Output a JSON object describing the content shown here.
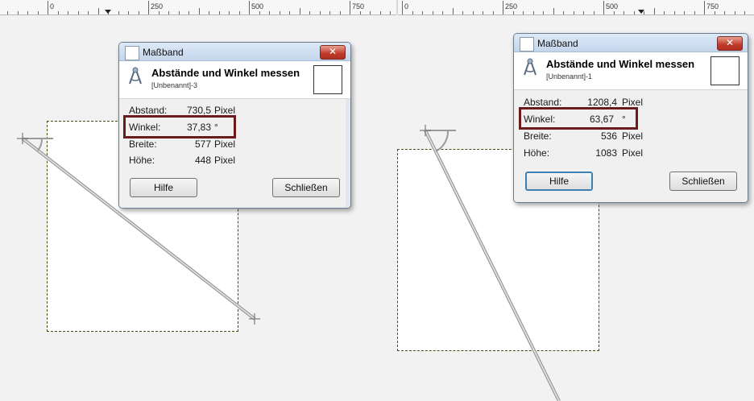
{
  "ruler_left": {
    "labels": [
      "0",
      "250",
      "500",
      "750"
    ]
  },
  "ruler_right": {
    "labels": [
      "0",
      "250",
      "500",
      "750"
    ]
  },
  "dialogs": [
    {
      "window_title": "Maßband",
      "close_glyph": "✕",
      "header_title": "Abstände und Winkel messen",
      "header_subtitle": "[Unbenannt]-3",
      "rows": [
        {
          "label": "Abstand:",
          "value": "730,5",
          "unit": "Pixel"
        },
        {
          "label": "Winkel:",
          "value": "37,83",
          "unit": "°"
        },
        {
          "label": "Breite:",
          "value": "577",
          "unit": "Pixel"
        },
        {
          "label": "Höhe:",
          "value": "448",
          "unit": "Pixel"
        }
      ],
      "help_label": "Hilfe",
      "close_label": "Schließen"
    },
    {
      "window_title": "Maßband",
      "close_glyph": "✕",
      "header_title": "Abstände und Winkel messen",
      "header_subtitle": "[Unbenannt]-1",
      "rows": [
        {
          "label": "Abstand:",
          "value": "1208,4",
          "unit": "Pixel"
        },
        {
          "label": "Winkel:",
          "value": "63,67",
          "unit": "°"
        },
        {
          "label": "Breite:",
          "value": "536",
          "unit": "Pixel"
        },
        {
          "label": "Höhe:",
          "value": "1083",
          "unit": "Pixel"
        }
      ],
      "help_label": "Hilfe",
      "close_label": "Schließen"
    }
  ]
}
